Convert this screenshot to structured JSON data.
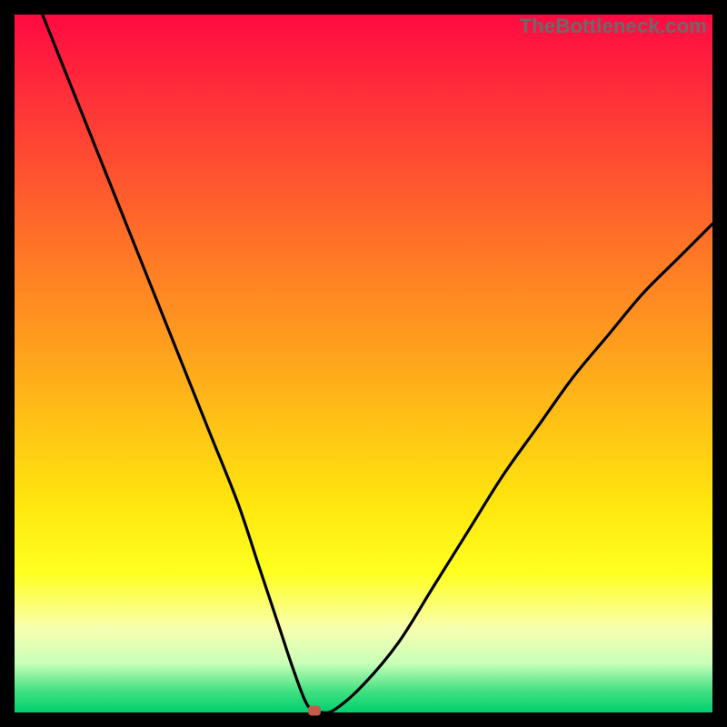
{
  "watermark": "TheBottleneck.com",
  "chart_data": {
    "type": "line",
    "title": "",
    "xlabel": "",
    "ylabel": "",
    "xlim": [
      0,
      100
    ],
    "ylim": [
      0,
      100
    ],
    "grid": false,
    "legend": false,
    "series": [
      {
        "name": "bottleneck-curve",
        "x": [
          4,
          8,
          12,
          16,
          20,
          24,
          28,
          32,
          35,
          38,
          40,
          42,
          44,
          46,
          50,
          55,
          60,
          65,
          70,
          75,
          80,
          85,
          90,
          95,
          100
        ],
        "values": [
          100,
          90,
          80,
          70,
          60,
          50,
          40,
          30,
          21,
          12,
          6,
          1,
          0,
          0.5,
          4,
          10,
          18,
          26,
          34,
          41,
          48,
          54,
          60,
          65,
          70
        ]
      }
    ],
    "marker": {
      "x": 43,
      "y": 0.3
    },
    "background": "rainbow-vertical"
  }
}
